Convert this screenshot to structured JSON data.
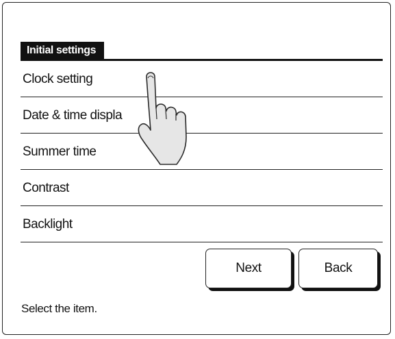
{
  "screen": {
    "title": "Initial settings",
    "menu_items": [
      {
        "label": "Clock setting"
      },
      {
        "label": "Date & time displa"
      },
      {
        "label": "Summer time"
      },
      {
        "label": "Contrast"
      },
      {
        "label": "Backlight"
      }
    ],
    "buttons": {
      "next_label": "Next",
      "back_label": "Back"
    },
    "status_text": "Select the item."
  },
  "icons": {
    "pointer": "pointing-hand-icon"
  }
}
